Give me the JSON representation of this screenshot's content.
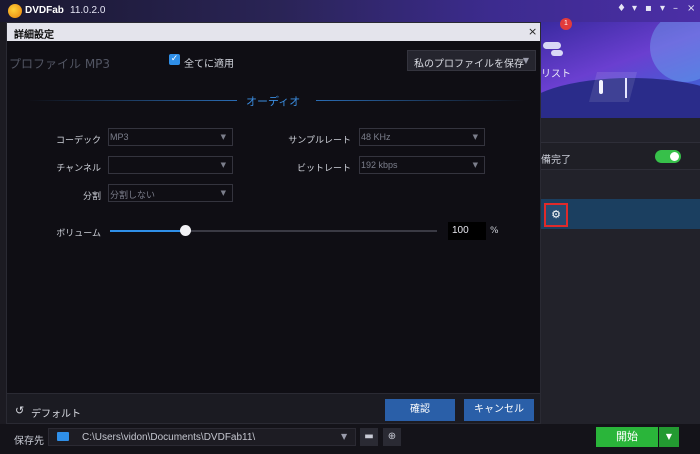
{
  "app": {
    "name": "DVDFab",
    "version": "11.0.2.0",
    "notification_count": "1",
    "list_label": "リスト"
  },
  "right_panel": {
    "status_text": "備完了"
  },
  "dialog": {
    "title": "詳細設定",
    "close_glyph": "×",
    "profile_title": "プロファイル MP3",
    "apply_all_label": "全てに適用",
    "save_profile_label": "私のプロファイルを保存",
    "section_title": "オーディオ",
    "fields": {
      "codec": {
        "label": "コーデック",
        "value": "MP3"
      },
      "sample_rate": {
        "label": "サンプルレート",
        "value": "48 KHz"
      },
      "channel": {
        "label": "チャンネル",
        "value": ""
      },
      "bitrate": {
        "label": "ビットレート",
        "value": "192 kbps"
      },
      "split": {
        "label": "分割",
        "value": "分割しない"
      }
    },
    "volume": {
      "label": "ボリューム",
      "value": "100",
      "unit": "%",
      "level_fraction": 0.23
    },
    "footer": {
      "default_label": "デフォルト",
      "ok_label": "確認",
      "cancel_label": "キャンセル"
    }
  },
  "bottom_bar": {
    "save_to_label": "保存先",
    "path": "C:\\Users\\vidon\\Documents\\DVDFab11\\",
    "start_label": "開始"
  },
  "colors": {
    "accent_blue": "#2f8fe8",
    "start_green": "#2ab53a",
    "highlight_red": "#e02a2a"
  }
}
